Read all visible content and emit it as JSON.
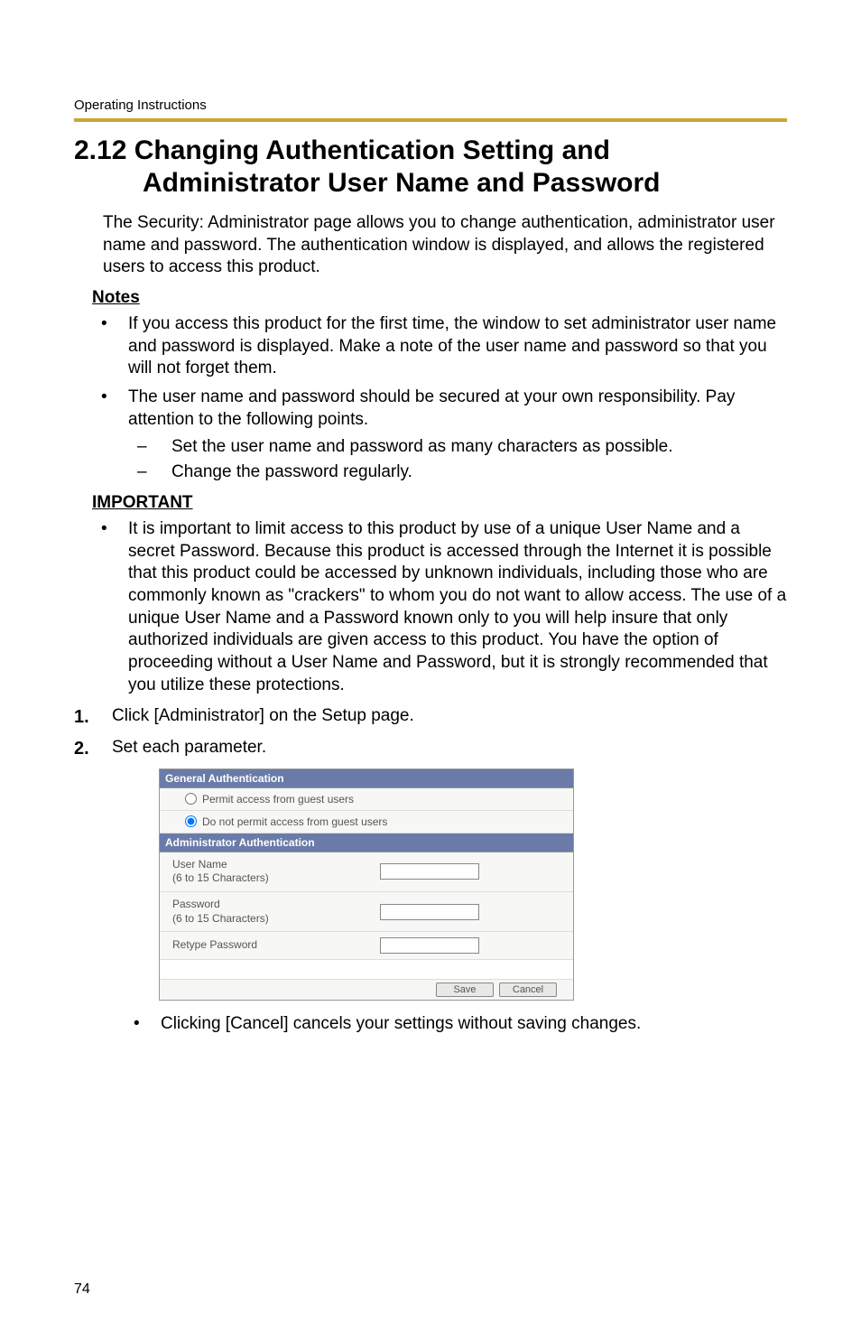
{
  "header": {
    "running_header": "Operating Instructions",
    "section_number": "2.12",
    "title_line1": "2.12  Changing Authentication Setting and",
    "title_line2": "Administrator User Name and Password"
  },
  "body": {
    "intro": "The Security: Administrator page allows you to change authentication, administrator user name and password. The authentication window is displayed, and allows the registered users to access this product.",
    "notes_heading": "Notes",
    "notes": [
      "If you access this product for the first time, the window to set administrator user name and password is displayed. Make a note of the user name and password so that you will not forget them.",
      "The user name and password should be secured at your own responsibility. Pay attention to the following points."
    ],
    "sub_notes": [
      "Set the user name and password as many characters as possible.",
      "Change the password regularly."
    ],
    "important_heading": "IMPORTANT",
    "important": [
      "It is important to limit access to this product by use of a unique User Name and a secret Password. Because this product is accessed through the Internet it is possible that this product could be accessed by unknown individuals, including those who are commonly known as \"crackers\" to whom you do not want to allow access. The use of a unique User Name and a Password known only to you will help insure that only authorized individuals are given access to this product. You have the option of proceeding without a User Name and Password, but it is strongly recommended that you utilize these protections."
    ],
    "steps": [
      "Click [Administrator] on the Setup page.",
      "Set each parameter."
    ],
    "cancel_note": "Clicking [Cancel] cancels your settings without saving changes."
  },
  "screenshot": {
    "general_auth_header": "General Authentication",
    "radio_permit": "Permit access from guest users",
    "radio_deny": "Do not permit access from guest users",
    "admin_auth_header": "Administrator Authentication",
    "username_label": "User Name\n(6 to 15 Characters)",
    "password_label": "Password\n(6 to 15 Characters)",
    "retype_label": "Retype Password",
    "save_button": "Save",
    "cancel_button": "Cancel",
    "radio_selected": "deny"
  },
  "footer": {
    "page_number": "74"
  }
}
